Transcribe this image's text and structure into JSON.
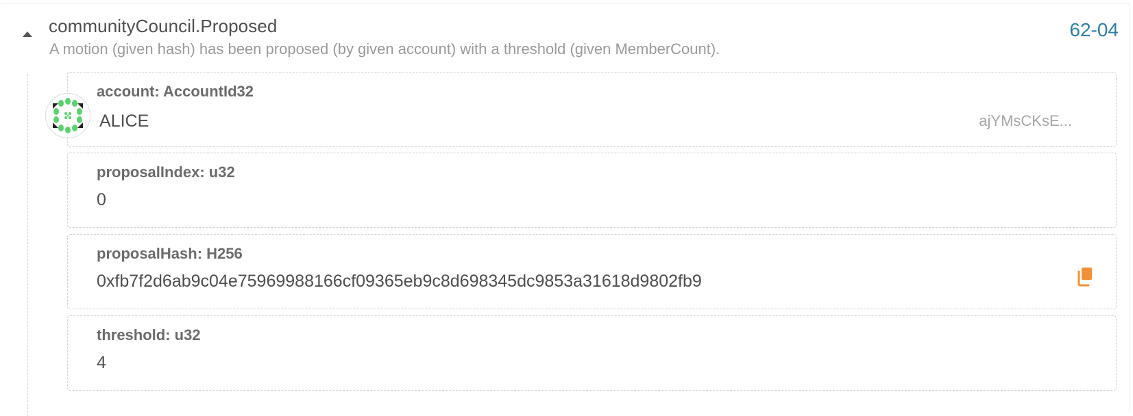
{
  "event": {
    "title": "communityCouncil.Proposed",
    "description": "A motion (given hash) has been proposed (by given account) with a threshold (given MemberCount).",
    "index": "62-04",
    "expanded": true
  },
  "params": {
    "account": {
      "label": "account: AccountId32",
      "name": "ALICE",
      "address_short": "ajYMsCKsE..."
    },
    "proposalIndex": {
      "label": "proposalIndex: u32",
      "value": "0"
    },
    "proposalHash": {
      "label": "proposalHash: H256",
      "value": "0xfb7f2d6ab9c04e75969988166cf09365eb9c8d698345dc9853a31618d9802fb9"
    },
    "threshold": {
      "label": "threshold: u32",
      "value": "4"
    }
  },
  "icons": {
    "toggle": "caret-up-icon",
    "copy": "copy-icon",
    "avatar": "identicon"
  },
  "colors": {
    "link": "#2c7fa8",
    "copy_icon": "#f19135",
    "identicon_green": "#5ad26d",
    "identicon_dark": "#222222"
  }
}
